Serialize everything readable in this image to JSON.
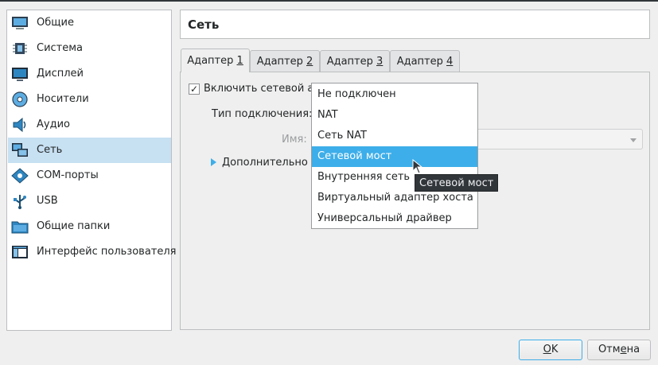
{
  "sidebar": {
    "items": [
      {
        "label": "Общие",
        "icon": "monitor-general-icon"
      },
      {
        "label": "Система",
        "icon": "chip-icon"
      },
      {
        "label": "Дисплей",
        "icon": "display-icon"
      },
      {
        "label": "Носители",
        "icon": "disc-icon"
      },
      {
        "label": "Аудио",
        "icon": "speaker-icon"
      },
      {
        "label": "Сеть",
        "icon": "network-icon"
      },
      {
        "label": "COM-порты",
        "icon": "serial-port-icon"
      },
      {
        "label": "USB",
        "icon": "usb-icon"
      },
      {
        "label": "Общие папки",
        "icon": "folder-icon"
      },
      {
        "label": "Интерфейс пользователя",
        "icon": "ui-window-icon"
      }
    ],
    "selected": "Сеть"
  },
  "header": {
    "title": "Сеть"
  },
  "tabs": [
    {
      "label": "Адаптер ",
      "mnemonic": "1"
    },
    {
      "label": "Адаптер ",
      "mnemonic": "2"
    },
    {
      "label": "Адаптер ",
      "mnemonic": "3"
    },
    {
      "label": "Адаптер ",
      "mnemonic": "4"
    }
  ],
  "active_tab": "Адаптер 1",
  "adapter": {
    "enable_label": "Включить сетевой ад",
    "enable_checked": true,
    "check_mark": "✓",
    "connection_type_label": "Тип подключения:",
    "name_label": "Имя:",
    "advanced_label": "Дополнительно"
  },
  "dropdown": {
    "options": [
      "Не подключен",
      "NAT",
      "Сеть NAT",
      "Сетевой мост",
      "Внутренняя сеть",
      "Виртуальный адаптер хоста",
      "Универсальный драйвер"
    ],
    "highlighted": "Сетевой мост"
  },
  "tooltip": "Сетевой мост",
  "buttons": {
    "ok": {
      "mnemonic": "O",
      "rest": "K"
    },
    "cancel": {
      "pre": "Отм",
      "mnemonic": "е",
      "rest": "на"
    }
  },
  "colors": {
    "selection": "#c7e0f2",
    "highlight": "#3daee9",
    "tooltip_bg": "#31363b"
  }
}
